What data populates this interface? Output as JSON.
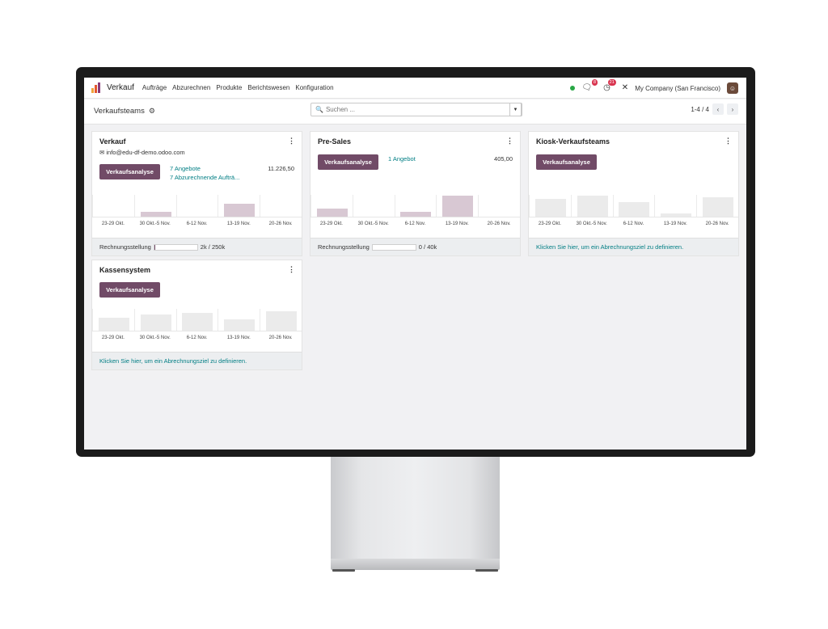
{
  "navbar": {
    "app_name": "Verkauf",
    "menu": [
      "Aufträge",
      "Abzurechnen",
      "Produkte",
      "Berichtswesen",
      "Konfiguration"
    ],
    "messages_badge": "8",
    "activities_badge": "21",
    "company": "My Company (San Francisco)"
  },
  "controlbar": {
    "title": "Verkaufsteams",
    "search_placeholder": "Suchen ...",
    "pager": "1-4 / 4"
  },
  "chart_labels": [
    "23-29 Okt.",
    "30 Okt.-5 Nov.",
    "6-12 Nov.",
    "13-19 Nov.",
    "20-26 Nov."
  ],
  "cards": [
    {
      "title": "Verkauf",
      "email": "info@edu-df-demo.odoo.com",
      "button": "Verkaufsanalyse",
      "link1": "7 Angebote",
      "link2": "7 Abzurechnende Aufträ...",
      "amount": "11.226,50",
      "footer_label": "Rechnungsstellung",
      "footer_value": "2k / 250k",
      "progress": 0.008
    },
    {
      "title": "Pre-Sales",
      "button": "Verkaufsanalyse",
      "link1": "1 Angebot",
      "amount": "405,00",
      "footer_label": "Rechnungsstellung",
      "footer_value": "0 /  40k",
      "progress": 0
    },
    {
      "title": "Kiosk-Verkaufsteams",
      "button": "Verkaufsanalyse",
      "footer_link": "Klicken Sie hier, um ein Abrechnungsziel zu definieren."
    },
    {
      "title": "Kassensystem",
      "button": "Verkaufsanalyse",
      "footer_link": "Klicken Sie hier, um ein Abrechnungsziel zu definieren."
    }
  ],
  "chart_data": [
    {
      "type": "bar",
      "title": "",
      "categories": [
        "23-29 Okt.",
        "30 Okt.-5 Nov.",
        "6-12 Nov.",
        "13-19 Nov.",
        "20-26 Nov."
      ],
      "values": [
        0,
        0.22,
        0,
        0.63,
        0
      ],
      "color": "#d8c8d3"
    },
    {
      "type": "bar",
      "title": "",
      "categories": [
        "23-29 Okt.",
        "30 Okt.-5 Nov.",
        "6-12 Nov.",
        "13-19 Nov.",
        "20-26 Nov."
      ],
      "values": [
        0.37,
        0,
        0.22,
        1.0,
        0
      ],
      "color": "#d8c8d3"
    },
    {
      "type": "bar",
      "title": "",
      "categories": [
        "23-29 Okt.",
        "30 Okt.-5 Nov.",
        "6-12 Nov.",
        "13-19 Nov.",
        "20-26 Nov."
      ],
      "values": [
        0.85,
        1.0,
        0.7,
        0.15,
        0.93
      ],
      "color": "#ebebeb"
    },
    {
      "type": "bar",
      "title": "",
      "categories": [
        "23-29 Okt.",
        "30 Okt.-5 Nov.",
        "6-12 Nov.",
        "13-19 Nov.",
        "20-26 Nov."
      ],
      "values": [
        0.6,
        0.78,
        0.85,
        0.52,
        0.93
      ],
      "color": "#ebebeb"
    }
  ]
}
